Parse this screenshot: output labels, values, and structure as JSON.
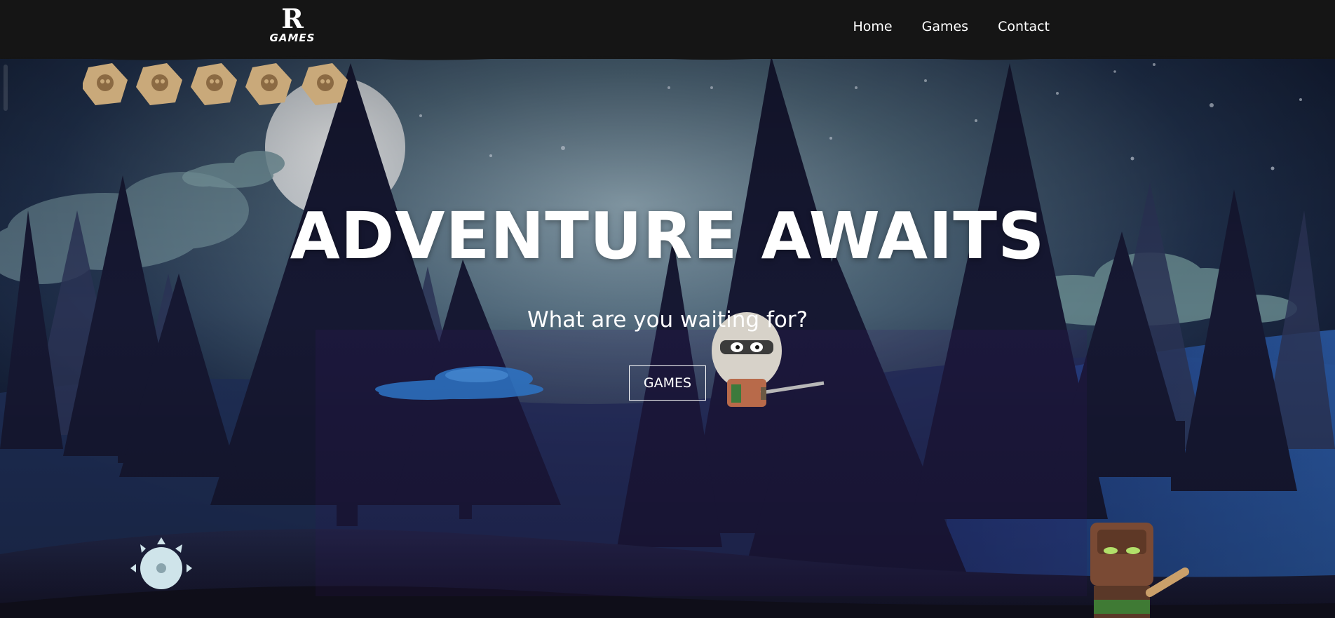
{
  "nav": {
    "logo_letter": "R",
    "logo_word": "GAMES",
    "links": [
      "Home",
      "Games",
      "Contact"
    ]
  },
  "hero": {
    "title": "ADVENTURE AWAITS",
    "subtitle": "What are you waiting for?",
    "button_label": "GAMES"
  },
  "colors": {
    "navbar": "#151515",
    "sky_top": "#111a33",
    "sky_glow": "#7f97a8",
    "tree_dark": "#13152b",
    "ground": "#1a1830",
    "text": "#ffffff"
  }
}
